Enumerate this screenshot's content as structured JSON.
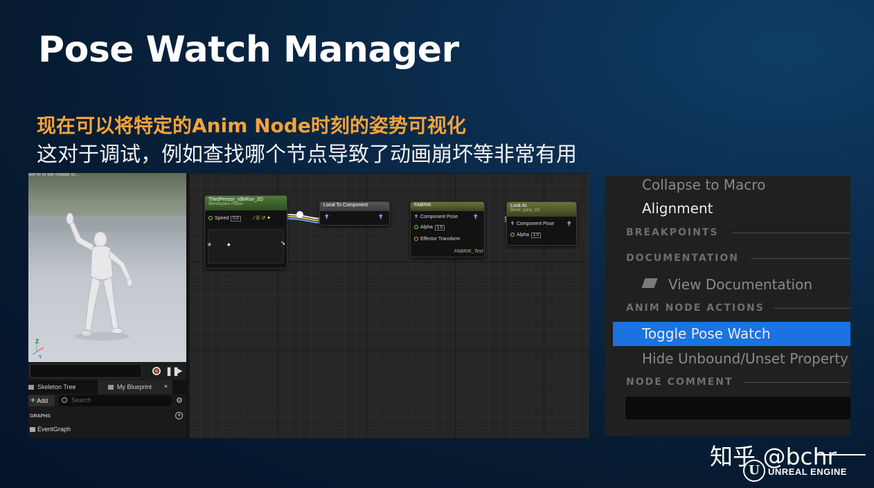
{
  "slide": {
    "title": "Pose Watch Manager",
    "subtitle_highlight": "现在可以将特定的Anim Node时刻的姿势可视化",
    "subtitle": "这对于调试，例如查找哪个节点导致了动画崩坏等非常有用"
  },
  "editor": {
    "viewport_caption": "We're in the middle of...",
    "tabs": {
      "skeleton_tree": "Skeleton Tree",
      "my_blueprint": "My Blueprint",
      "close_glyph": "×"
    },
    "toolbar": {
      "add_label": "Add",
      "search_placeholder": "Search"
    },
    "graphs_section": "GRAPHS",
    "event_graph": "EventGraph",
    "nodes": {
      "idle_run": {
        "title": "ThirdPerson_IdleRun_2D",
        "subtitle": "Blendspace Player",
        "speed_label": "Speed",
        "speed_value": "0.0"
      },
      "local_to_component": {
        "title": "Local To Component"
      },
      "fabrik": {
        "title": "FABRIK",
        "component_pose": "Component Pose",
        "alpha_label": "Alpha",
        "alpha_value": "1.0",
        "effector_transform": "Effector Transform",
        "footer": "FABRIK_Test"
      },
      "look_at": {
        "title": "Look At",
        "subtitle": "Bone: spine_03",
        "component_pose": "Component Pose",
        "alpha_label": "Alpha",
        "alpha_value": "1.0"
      }
    },
    "accent_colors": {
      "blendspace_header": "#4f7a3a",
      "convert_header": "#555555",
      "skeletal_control_header": "#6a7339"
    }
  },
  "context_menu": {
    "collapse_to_macro": "Collapse to Macro",
    "alignment": "Alignment",
    "breakpoints_section": "BREAKPOINTS",
    "documentation_section": "DOCUMENTATION",
    "view_documentation": "View Documentation",
    "anim_node_actions_section": "ANIM NODE ACTIONS",
    "toggle_pose_watch": "Toggle Pose Watch",
    "hide_unbound": "Hide Unbound/Unset Property",
    "node_comment_section": "NODE COMMENT",
    "highlight_color": "#1a73e0"
  },
  "watermark": "知乎 @bchr",
  "brand": "UNREAL ENGINE"
}
